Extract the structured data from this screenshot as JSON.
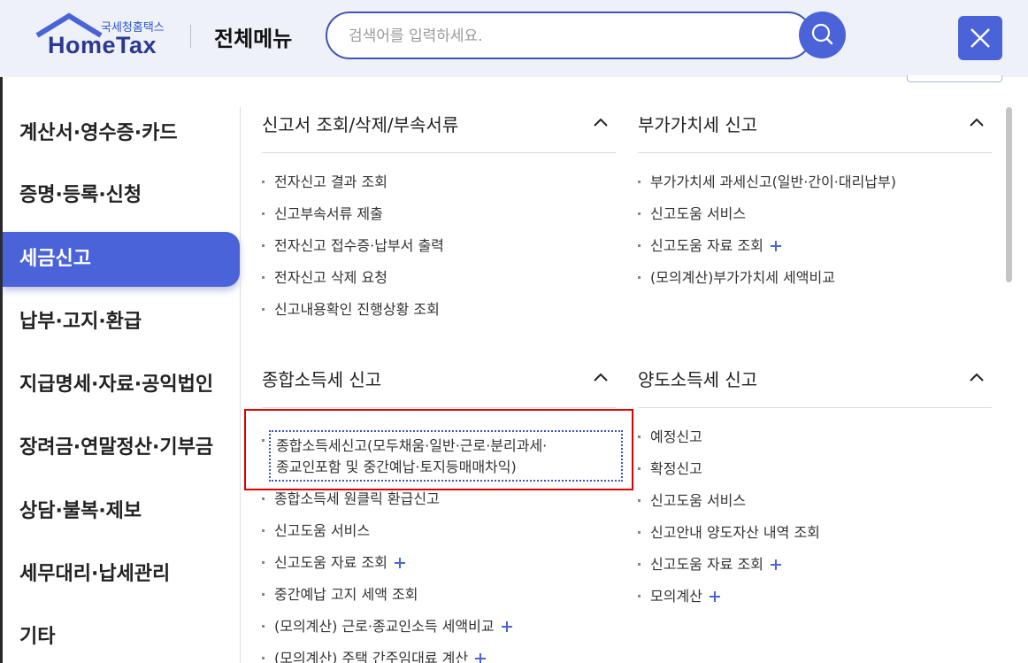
{
  "header": {
    "logo_sub": "국세청홈택스",
    "logo_main": "HomeTax",
    "menu_title": "전체메뉴",
    "search_placeholder": "검색어를 입력하세요."
  },
  "sidebar": {
    "items": [
      {
        "label": "계산서·영수증·카드"
      },
      {
        "label": "증명·등록·신청"
      },
      {
        "label": "세금신고",
        "active": true
      },
      {
        "label": "납부·고지·환급"
      },
      {
        "label": "지급명세·자료·공익법인"
      },
      {
        "label": "장려금·연말정산·기부금"
      },
      {
        "label": "상담·불복·제보"
      },
      {
        "label": "세무대리·납세관리"
      },
      {
        "label": "기타"
      }
    ]
  },
  "sections": {
    "report_lookup": {
      "title": "신고서 조회/삭제/부속서류",
      "items": [
        {
          "label": "전자신고 결과 조회"
        },
        {
          "label": "신고부속서류 제출"
        },
        {
          "label": "전자신고 접수증·납부서 출력"
        },
        {
          "label": "전자신고 삭제 요청"
        },
        {
          "label": "신고내용확인 진행상황 조회"
        }
      ]
    },
    "vat": {
      "title": "부가가치세 신고",
      "items": [
        {
          "label": "부가가치세 과세신고(일반·간이·대리납부)"
        },
        {
          "label": "신고도움 서비스"
        },
        {
          "label": "신고도움 자료 조회",
          "plus": true
        },
        {
          "label": "(모의계산)부가가치세 세액비교"
        }
      ]
    },
    "income_tax": {
      "title": "종합소득세 신고",
      "highlighted_line1": "종합소득세신고(모두채움·일반·근로·분리과세·",
      "highlighted_line2": "종교인포함 및 중간예납·토지등매매차익)",
      "items": [
        {
          "label": "종합소득세 원클릭 환급신고"
        },
        {
          "label": "신고도움 서비스"
        },
        {
          "label": "신고도움 자료 조회",
          "plus": true
        },
        {
          "label": "중간예납 고지 세액 조회"
        },
        {
          "label": "(모의계산) 근로·종교인소득 세액비교",
          "plus": true
        },
        {
          "label": "(모의계산) 주택 간주임대료 계산",
          "plus": true
        }
      ]
    },
    "capital_gains": {
      "title": "양도소득세 신고",
      "items": [
        {
          "label": "예정신고"
        },
        {
          "label": "확정신고"
        },
        {
          "label": "신고도움 서비스"
        },
        {
          "label": "신고안내 양도자산 내역 조회"
        },
        {
          "label": "신고도움 자료 조회",
          "plus": true
        },
        {
          "label": "모의계산",
          "plus": true
        }
      ]
    }
  },
  "colors": {
    "accent": "#4a63d8",
    "header_bg": "#eef1f8",
    "highlight_border": "#e00000"
  }
}
